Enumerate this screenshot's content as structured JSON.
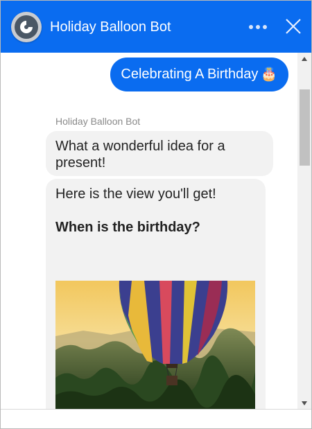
{
  "header": {
    "title": "Holiday Balloon Bot",
    "brand_color": "#0a6cf0",
    "more_icon": "more-horizontal-icon",
    "close_icon": "close-icon",
    "avatar_icon": "bot-logo-icon"
  },
  "messages": {
    "user_message": "Celebrating A Birthday",
    "user_emoji": "🎂",
    "bot_name": "Holiday Balloon Bot",
    "bot_message_1": "What a wonderful idea for a present!",
    "bot_message_2": "Here is the view you'll get!",
    "bot_question": "When is the birthday?"
  },
  "composer": {
    "placeholder": "",
    "value": ""
  },
  "colors": {
    "bot_bubble_bg": "#f2f2f2",
    "user_bubble_bg": "#0a6cf0"
  }
}
